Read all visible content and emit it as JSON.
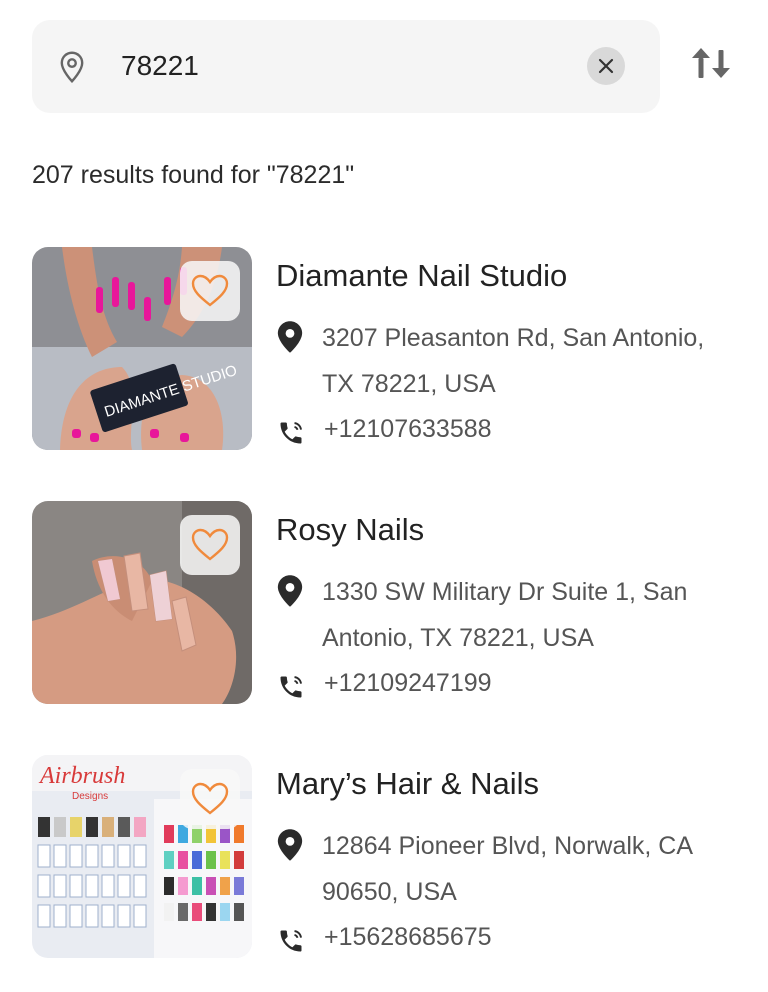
{
  "search": {
    "value": "78221",
    "icon": "location-pin-icon",
    "clear_icon": "close-icon"
  },
  "sort_icon": "sort-icon",
  "results_text": "207 results found for \"78221\"",
  "accent_color": "#f08a3c",
  "listings": [
    {
      "name": "Diamante Nail Studio",
      "address": "3207 Pleasanton Rd, San Antonio, TX 78221, USA",
      "phone": "+12107633588",
      "thumb_text": "DIAMANTE STUDIO",
      "favorite": false
    },
    {
      "name": "Rosy Nails",
      "address": "1330 SW Military Dr Suite 1, San Antonio, TX 78221, USA",
      "phone": "+12109247199",
      "favorite": false
    },
    {
      "name": "Mary’s Hair & Nails",
      "address": "12864 Pioneer Blvd, Norwalk, CA 90650, USA",
      "phone": "+15628685675",
      "thumb_text": "Airbrush",
      "thumb_subtext": "Designs",
      "favorite": false
    }
  ]
}
